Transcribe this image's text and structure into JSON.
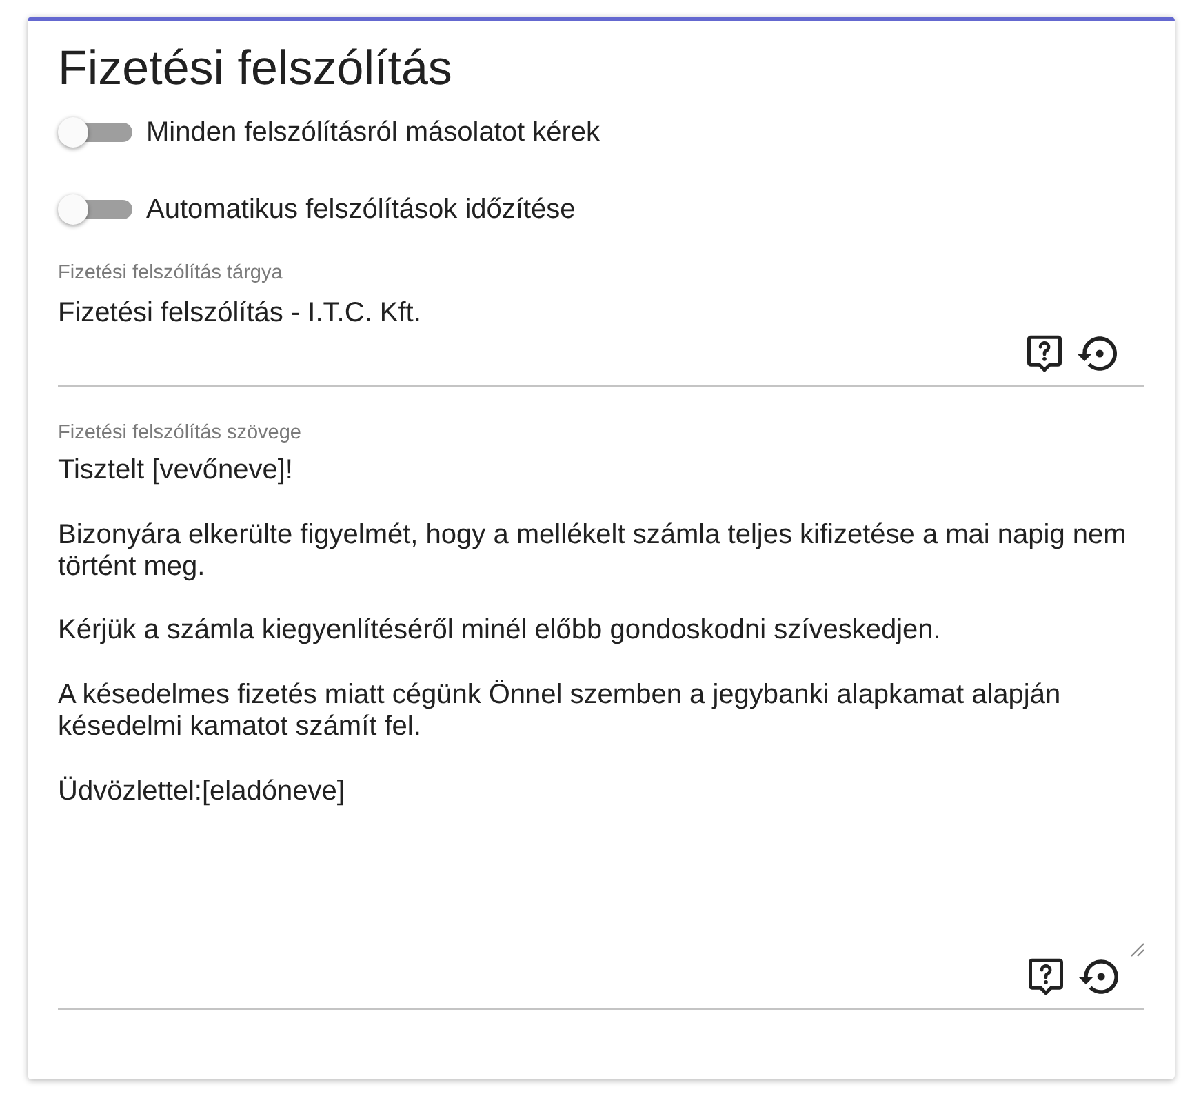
{
  "card": {
    "title": "Fizetési felszólítás"
  },
  "toggles": [
    {
      "label": "Minden felszólításról másolatot kérek",
      "on": false
    },
    {
      "label": "Automatikus felszólítások időzítése",
      "on": false
    }
  ],
  "fields": [
    {
      "kind": "input",
      "label": "Fizetési felszólítás tárgya",
      "value": "Fizetési felszólítás - I.T.C. Kft."
    },
    {
      "kind": "textarea",
      "label": "Fizetési felszólítás szövege",
      "paragraphs": [
        "Tisztelt [vevőneve]!",
        "Bizonyára elkerülte figyelmét, hogy a mellékelt számla teljes kifizetése a mai napig nem történt meg.",
        "Kérjük a számla kiegyenlítéséről minél előbb gondoskodni szíveskedjen.",
        "A késedelmes fizetés miatt cégünk Önnel szemben a jegybanki alapkamat alapján késedelmi kamatot számít fel.",
        "Üdvözlettel:[eladóneve]"
      ]
    }
  ]
}
